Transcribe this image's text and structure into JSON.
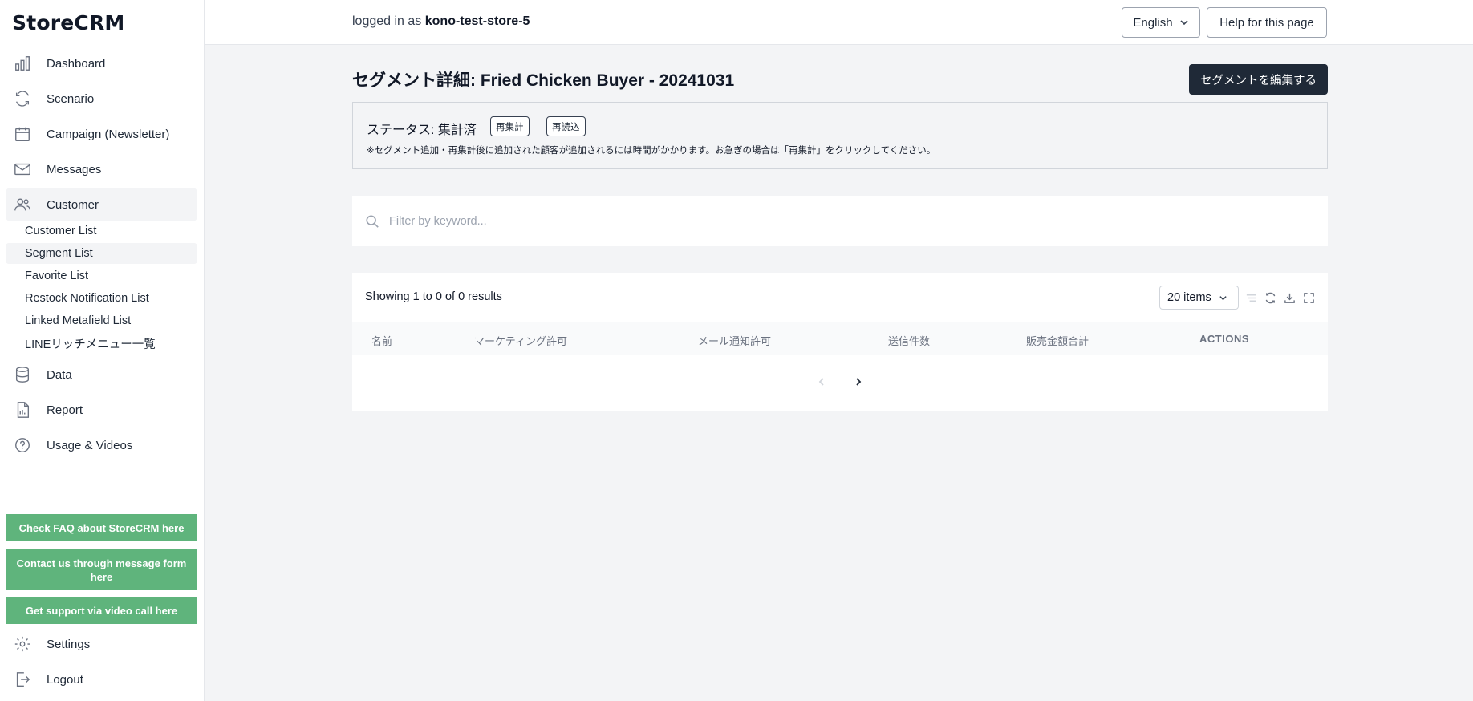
{
  "app": {
    "logo": "StoreCRM"
  },
  "sidebar": {
    "items": [
      {
        "label": "Dashboard",
        "icon": "bar-chart-icon"
      },
      {
        "label": "Scenario",
        "icon": "refresh-icon"
      },
      {
        "label": "Campaign (Newsletter)",
        "icon": "calendar-icon"
      },
      {
        "label": "Messages",
        "icon": "mail-icon"
      },
      {
        "label": "Customer",
        "icon": "users-icon"
      },
      {
        "label": "Data",
        "icon": "database-icon"
      },
      {
        "label": "Report",
        "icon": "document-icon"
      },
      {
        "label": "Usage & Videos",
        "icon": "question-circle-icon"
      }
    ],
    "customer_sub": [
      {
        "label": "Customer List"
      },
      {
        "label": "Segment List"
      },
      {
        "label": "Favorite List"
      },
      {
        "label": "Restock Notification List"
      },
      {
        "label": "Linked Metafield List"
      },
      {
        "label": "LINEリッチメニュー一覧"
      }
    ],
    "support": [
      {
        "label": "Check FAQ about StoreCRM here"
      },
      {
        "label": "Contact us through message form here"
      },
      {
        "label": "Get support via video call here"
      }
    ],
    "bottom": [
      {
        "label": "Settings",
        "icon": "gear-icon"
      },
      {
        "label": "Logout",
        "icon": "logout-icon"
      }
    ],
    "support_color": "#5fb47c"
  },
  "header": {
    "logged_prefix": "logged in as",
    "store": "kono-test-store-5",
    "language": "English",
    "help": "Help for this page"
  },
  "main": {
    "title": "セグメント詳細: Fried Chicken Buyer - 20241031",
    "edit_button": "セグメントを編集する",
    "status": {
      "label": "ステータス: 集計済",
      "recount": "再集計",
      "reload": "再読込",
      "note": "※セグメント追加・再集計後に追加された顧客が追加されるには時間がかかります。お急ぎの場合は「再集計」をクリックしてください。"
    },
    "search": {
      "placeholder": "Filter by keyword..."
    },
    "table": {
      "results": "Showing 1 to 0 of 0 results",
      "page_size": "20 items",
      "columns": [
        "名前",
        "マーケティング許可",
        "メール通知許可",
        "送信件数",
        "販売金額合計",
        "ACTIONS"
      ],
      "rows": []
    }
  }
}
